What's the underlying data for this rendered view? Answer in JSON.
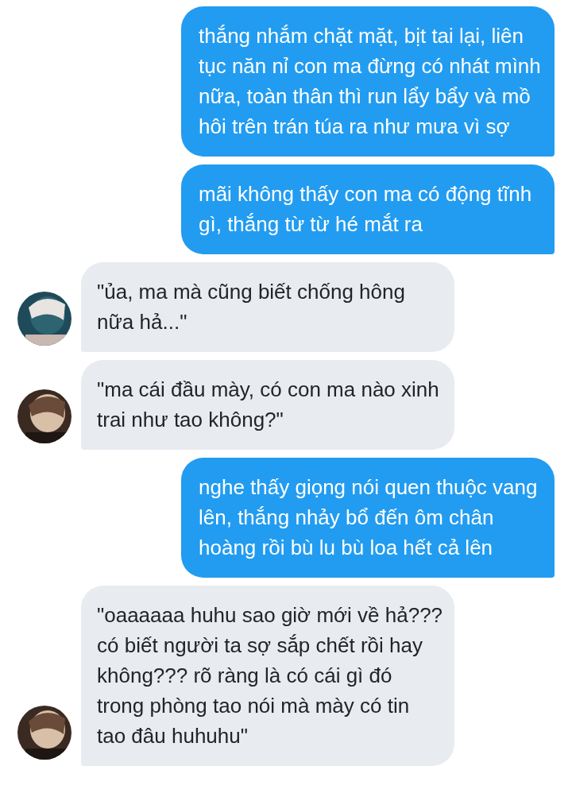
{
  "messages": [
    {
      "outgoing": true,
      "text": "thắng nhắm chặt mặt, bịt tai lại, liên tục năn nỉ con ma đừng có nhát mình nữa, toàn thân thì run lẩy bẩy và mồ hôi trên trán túa ra như mưa vì sợ"
    },
    {
      "outgoing": true,
      "text": "mãi không thấy con ma có động tĩnh gì, thắng từ từ hé mắt ra"
    },
    {
      "outgoing": false,
      "text": "\"ủa, ma mà cũng biết chống hông nữa hả...\""
    },
    {
      "outgoing": false,
      "text": "\"ma cái đầu mày, có con ma nào xinh trai như tao không?\""
    },
    {
      "outgoing": true,
      "text": "nghe thấy giọng nói quen thuộc vang lên, thắng nhảy bổ đến ôm chân hoàng rồi bù lu bù loa hết cả lên"
    },
    {
      "outgoing": false,
      "text": "\"oaaaaaa huhu sao giờ mới về hả??? có biết người ta sợ sắp chết rồi hay không??? rõ ràng là có cái gì đó trong phòng tao nói mà mày có tin tao đâu huhuhu\""
    }
  ]
}
